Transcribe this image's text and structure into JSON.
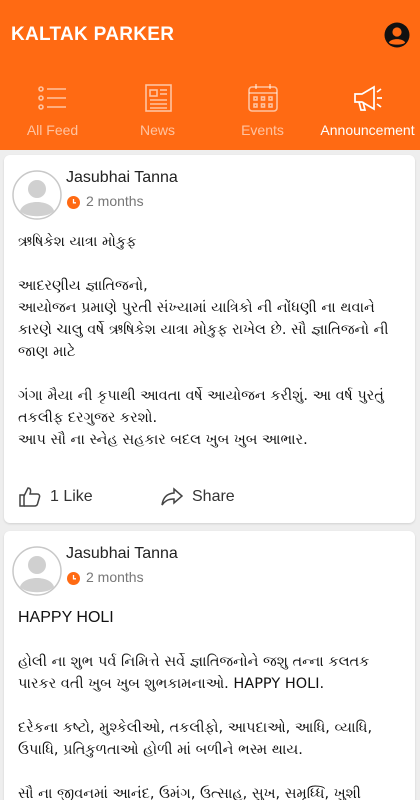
{
  "header": {
    "title": "KALTAK PARKER",
    "accent_color": "#ff6a13"
  },
  "tabs": [
    {
      "label": "All Feed",
      "icon": "list-icon"
    },
    {
      "label": "News",
      "icon": "newspaper-icon"
    },
    {
      "label": "Events",
      "icon": "calendar-icon"
    },
    {
      "label": "Announcement",
      "icon": "megaphone-icon",
      "active": true
    }
  ],
  "posts": [
    {
      "author": "Jasubhai Tanna",
      "time": "2 months",
      "paragraphs": [
        "ઋષિકેશ યાત્રા મોકુફ",
        "આદરણીય જ્ઞાતિજનો,\nઆયોજન પ્રમાણે પુરતી સંખ્યામાં યાત્રિકો ની નોંધણી ના થવાને કારણે ચાલુ વર્ષે ઋષિકેશ યાત્રા મોકુફ રાખેલ છે. સૌ જ્ઞાતિજનો ની જાણ માટે",
        "ગંગા મૈયા ની કૃપાથી આવતા વર્ષે આયોજન કરીશું. આ વર્ષ પુરતું તકલીફ દરગુજર કરશો.\nઆપ સૌ ના સ્નેહ સહકાર બદલ ખુબ ખુબ આભાર."
      ],
      "like_label": "1 Like",
      "share_label": "Share"
    },
    {
      "author": "Jasubhai Tanna",
      "time": "2 months",
      "paragraphs": [
        "HAPPY HOLI",
        "હોલી ના શુભ પર્વ નિમિત્તે સર્વે જ્ઞાતિજનોને જશુ તન્ના કલતક પારકર વતી ખુબ ખુબ શુભકામનાઓ. HAPPY HOLI.",
        "દરેકના કષ્ટો, મુશ્કેલીઓ, તકલીફો, આપદાઓ, આધિ, વ્યાધિ, ઉપાધિ, પ્રતિકુળતાઓ હોળી માં બળીને ભસ્મ થાય.",
        "સૌ ના જીવનમાં આનંદ, ઉમંગ, ઉત્સાહ, સુખ, સમૃધ્ધિ, ખુશી"
      ]
    }
  ]
}
